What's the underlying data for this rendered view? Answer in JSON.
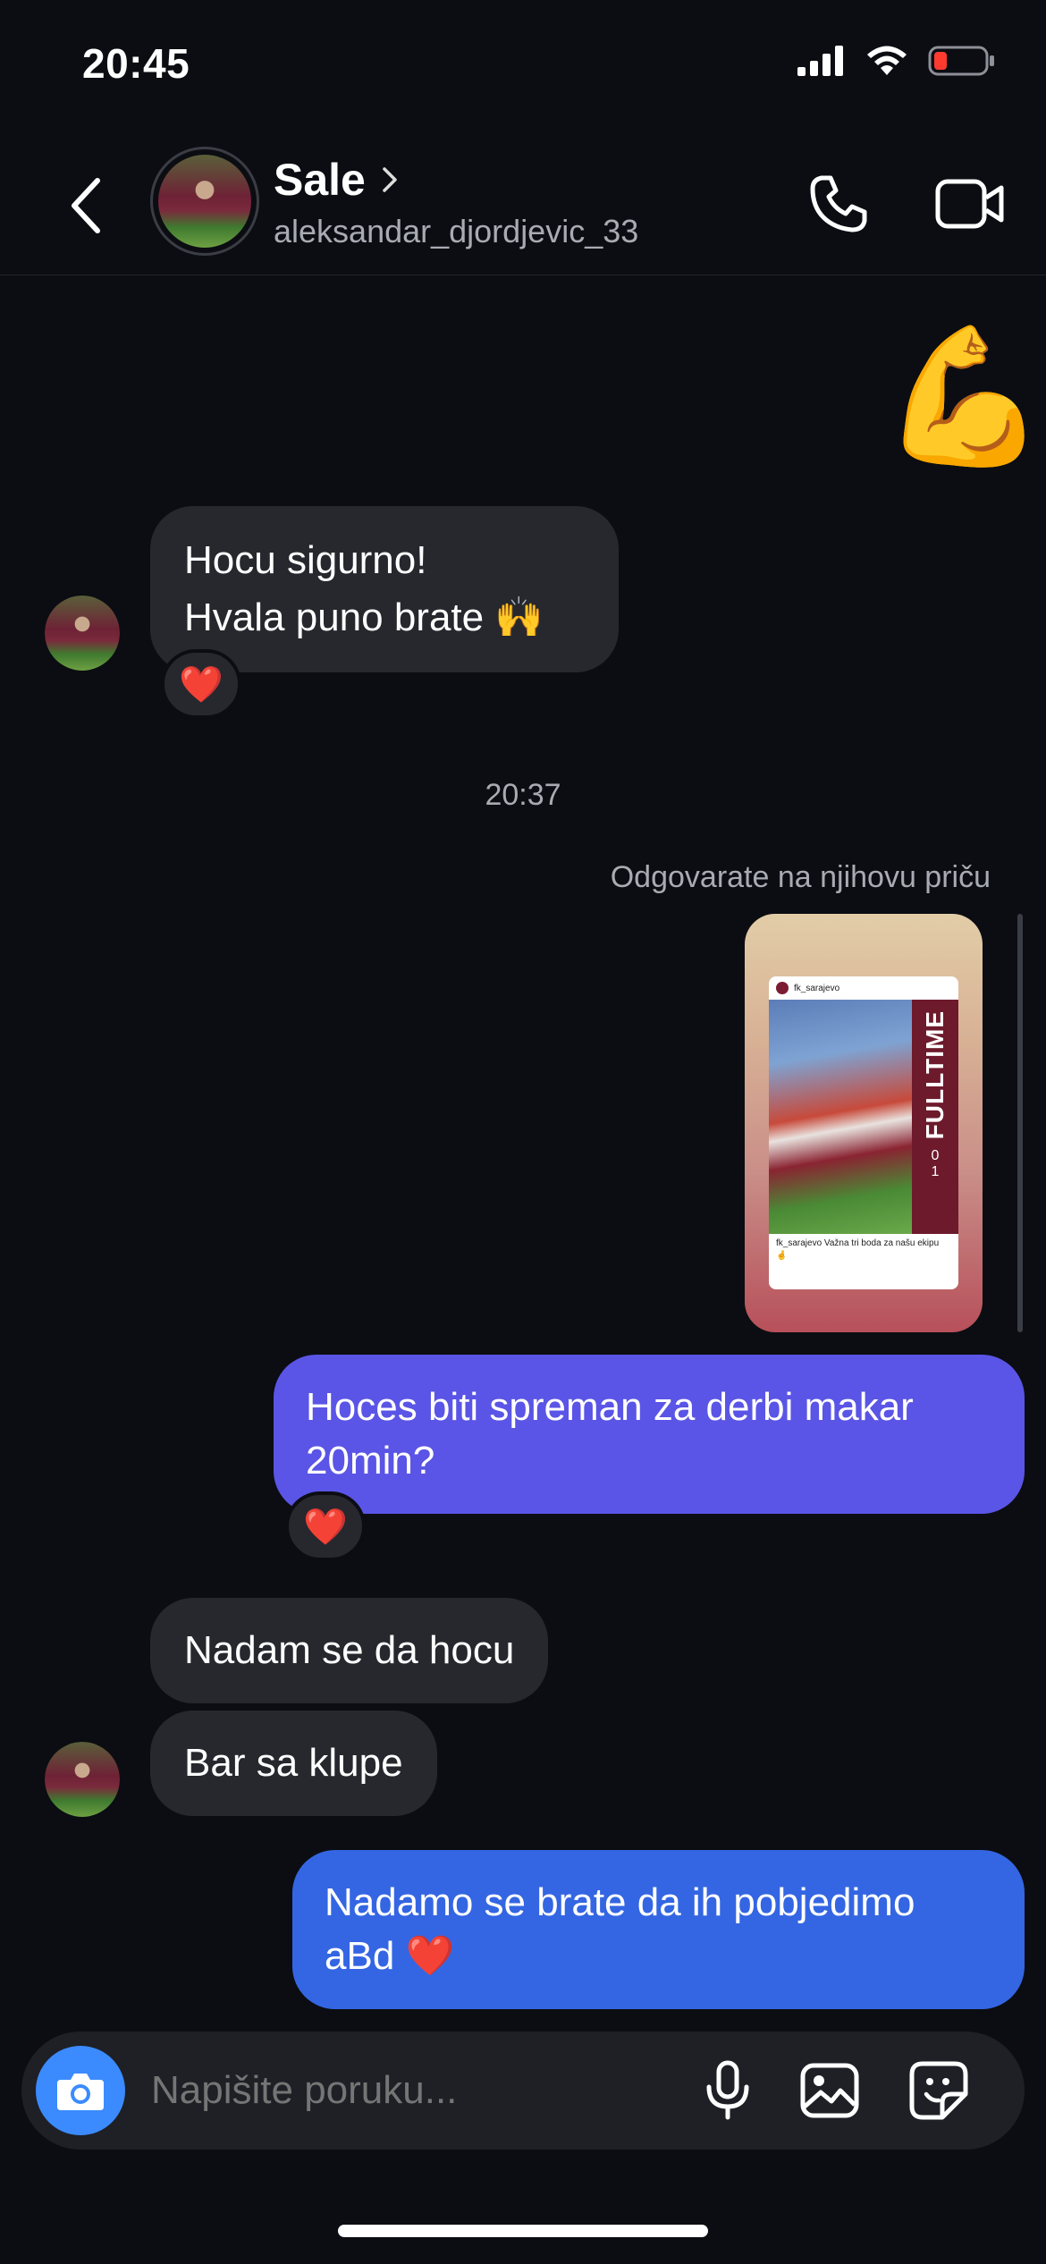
{
  "status_bar": {
    "time": "20:45",
    "battery_color": "#ff3b30"
  },
  "header": {
    "name": "Sale",
    "username": "aleksandar_djordjevic_33",
    "icons": [
      "back-icon",
      "chevron-right-icon",
      "phone-icon",
      "video-camera-icon"
    ]
  },
  "messages": {
    "sticker": "💪",
    "msg1_line1": "Hocu sigurno!",
    "msg1_line2": "Hvala puno brate 🙌",
    "reaction_heart": "❤️",
    "timestamp": "20:37",
    "reply_label": "Odgovarate na njihovu priču",
    "story": {
      "account": "fk_sarajevo",
      "title": "FULLTIME",
      "score_home": "0",
      "score_away": "1",
      "caption": "fk_sarajevo Važna tri boda za našu ekipu 🤞"
    },
    "msg2": "Hoces biti spreman za derbi makar 20min?",
    "msg3": "Nadam se da hocu",
    "msg4": "Bar sa klupe",
    "msg5": "Nadamo se brate da ih pobjedimo aBd ❤️"
  },
  "composer": {
    "placeholder": "Napišite poruku...",
    "icons": [
      "camera-icon",
      "microphone-icon",
      "gallery-icon",
      "sticker-icon"
    ]
  },
  "colors": {
    "background": "#0b0d12",
    "incoming_bubble": "#26282e",
    "outgoing_purple": "#5a55e6",
    "outgoing_blue": "#3466e3",
    "accent_blue": "#3b8bff"
  }
}
